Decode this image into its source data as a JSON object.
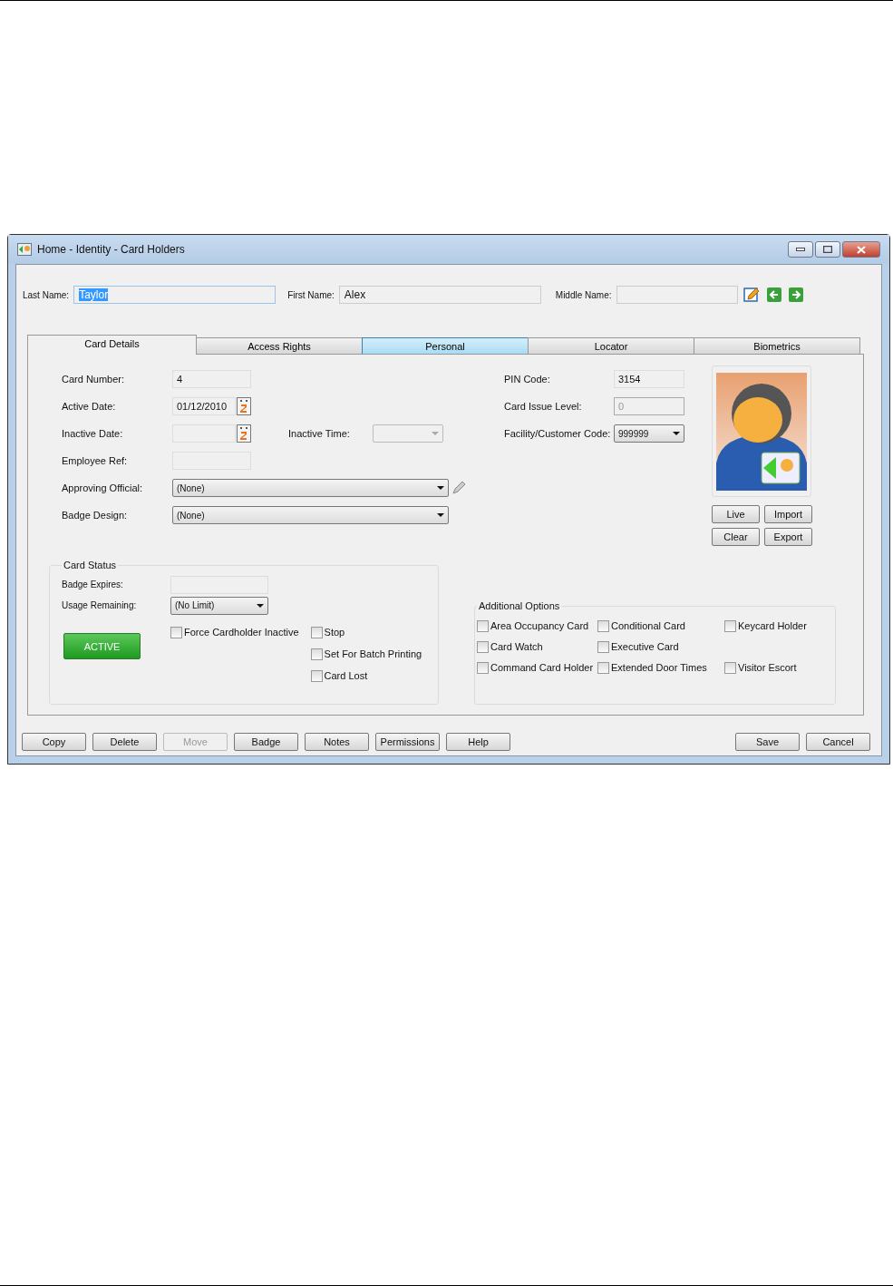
{
  "window": {
    "title": "Home - Identity - Card Holders"
  },
  "name_fields": [
    {
      "label": "Last Name:",
      "value": "Taylor",
      "selected": true
    },
    {
      "label": "First Name:",
      "value": "Alex",
      "selected": false
    },
    {
      "label": "Middle Name:",
      "selected": false
    }
  ],
  "tabs": [
    {
      "label": "Card Details",
      "selected": true,
      "hovered": false
    },
    {
      "label": "Access Rights",
      "selected": false,
      "hovered": false
    },
    {
      "label": "Personal",
      "selected": false,
      "hovered": true
    },
    {
      "label": "Locator",
      "selected": false,
      "hovered": false
    },
    {
      "label": "Biometrics",
      "selected": false,
      "hovered": false
    }
  ],
  "left_rows": [
    {
      "label": "Card Number:",
      "kind": "text",
      "value": "4"
    },
    {
      "label": "Active Date:",
      "kind": "date",
      "value": "01/12/2010"
    },
    {
      "label": "Inactive Date:",
      "kind": "date",
      "extra": {
        "label": "Inactive Time:",
        "kind": "dropdown",
        "disabled": true
      }
    },
    {
      "label": "Employee Ref:",
      "kind": "text"
    },
    {
      "label": "Approving Official:",
      "kind": "combo",
      "value": "(None)",
      "picker": true
    },
    {
      "label": "Badge Design:",
      "kind": "combo",
      "value": "(None)",
      "picker": false
    }
  ],
  "right_rows": [
    {
      "label": "PIN Code:",
      "kind": "text",
      "value": "3154",
      "disabled": false
    },
    {
      "label": "Card Issue Level:",
      "kind": "text",
      "value": "0",
      "disabled": true
    },
    {
      "label": "Facility/Customer Code:",
      "kind": "dropdown",
      "value": "999999",
      "disabled": false
    }
  ],
  "photo_buttons": [
    "Live",
    "Import",
    "Clear",
    "Export"
  ],
  "card_status": {
    "title": "Card Status",
    "rows": [
      {
        "label": "Badge Expires:",
        "kind": "text"
      },
      {
        "label": "Usage Remaining:",
        "kind": "dropdown",
        "value": "(No Limit)"
      }
    ],
    "status_button": "ACTIVE",
    "checkboxes": [
      {
        "label": "Force Cardholder Inactive",
        "checked": false
      },
      {
        "label": "Stop",
        "checked": false
      },
      {
        "label": "Set For Batch Printing",
        "checked": false
      },
      {
        "label": "Card Lost",
        "checked": false
      }
    ]
  },
  "additional_options": {
    "title": "Additional Options",
    "rows": [
      [
        {
          "label": "Area Occupancy Card",
          "checked": false
        },
        {
          "label": "Conditional Card",
          "checked": false
        },
        {
          "label": "Keycard Holder",
          "checked": false
        }
      ],
      [
        {
          "label": "Card Watch",
          "checked": false
        },
        {
          "label": "Executive Card",
          "checked": false
        }
      ],
      [
        {
          "label": "Command Card Holder",
          "checked": false
        },
        {
          "label": "Extended Door Times",
          "checked": false
        },
        {
          "label": "Visitor Escort",
          "checked": false
        }
      ]
    ]
  },
  "buttons_left": [
    {
      "label": "Copy",
      "disabled": false
    },
    {
      "label": "Delete",
      "disabled": false
    },
    {
      "label": "Move",
      "disabled": true
    },
    {
      "label": "Badge",
      "disabled": false
    },
    {
      "label": "Notes",
      "disabled": false
    },
    {
      "label": "Permissions",
      "disabled": false
    },
    {
      "label": "Help",
      "disabled": false
    }
  ],
  "buttons_right": [
    {
      "label": "Save",
      "disabled": false
    },
    {
      "label": "Cancel",
      "disabled": false
    }
  ]
}
